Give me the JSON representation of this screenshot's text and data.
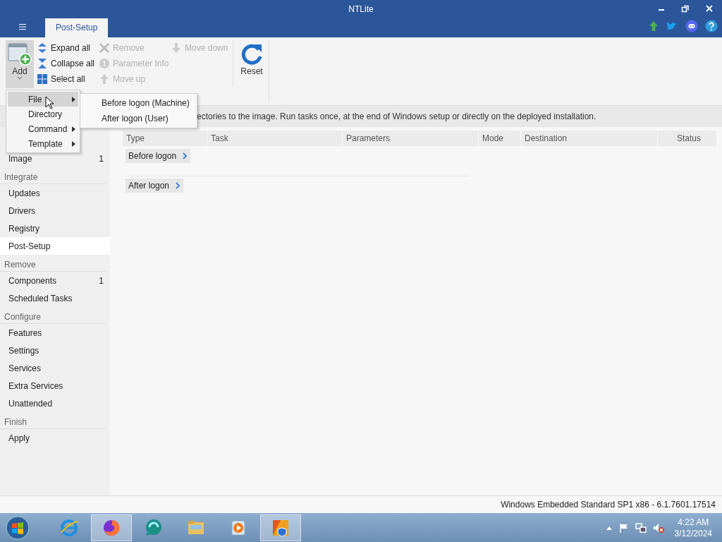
{
  "window": {
    "title": "NTLite"
  },
  "ribbon": {
    "tabs": [
      {
        "label": "Post-Setup",
        "selected": true
      }
    ],
    "add_button": {
      "label": "Add",
      "pressed": true
    },
    "small_columns": [
      [
        {
          "label": "Expand all",
          "disabled": false
        },
        {
          "label": "Collapse all",
          "disabled": false
        },
        {
          "label": "Select all",
          "disabled": false
        }
      ],
      [
        {
          "label": "Remove",
          "disabled": true
        },
        {
          "label": "Parameter Info",
          "disabled": true
        },
        {
          "label": "Move up",
          "disabled": true
        }
      ],
      [
        {
          "label": "Move down",
          "disabled": true
        }
      ]
    ],
    "reset_button": {
      "label": "Reset"
    }
  },
  "add_menu": {
    "items": [
      {
        "label": "File",
        "kind": "submenu",
        "selected": true
      },
      {
        "label": "Directory",
        "kind": "plain",
        "selected": false
      },
      {
        "label": "Command",
        "kind": "submenu",
        "selected": false
      },
      {
        "label": "Template",
        "kind": "submenu",
        "selected": false
      }
    ],
    "submenu": [
      "Before logon (Machine)",
      "After logon (User)"
    ]
  },
  "description": "ectories to the image. Run tasks once, at the end of Windows setup or directly on the deployed installation.",
  "sidebar": {
    "sections": [
      {
        "items": [
          {
            "label": "Image",
            "count": "1",
            "selected": false
          }
        ]
      },
      {
        "title": "Integrate",
        "items": [
          {
            "label": "Updates",
            "selected": false
          },
          {
            "label": "Drivers",
            "selected": false
          },
          {
            "label": "Registry",
            "selected": false
          },
          {
            "label": "Post-Setup",
            "selected": true
          }
        ]
      },
      {
        "title": "Remove",
        "items": [
          {
            "label": "Components",
            "count": "1",
            "selected": false
          },
          {
            "label": "Scheduled Tasks",
            "selected": false
          }
        ]
      },
      {
        "title": "Configure",
        "items": [
          {
            "label": "Features",
            "selected": false
          },
          {
            "label": "Settings",
            "selected": false
          },
          {
            "label": "Services",
            "selected": false
          },
          {
            "label": "Extra Services",
            "selected": false
          },
          {
            "label": "Unattended",
            "selected": false
          }
        ]
      },
      {
        "title": "Finish",
        "items": [
          {
            "label": "Apply",
            "selected": false
          }
        ]
      }
    ]
  },
  "table": {
    "columns": [
      "Type",
      "Task",
      "Parameters",
      "Mode",
      "Destination",
      "Status"
    ],
    "groups": [
      {
        "label": "Before logon",
        "expanded": false
      },
      {
        "label": "After logon",
        "expanded": false
      }
    ]
  },
  "status_bar": "Windows Embedded Standard SP1 x86 - 6.1.7601.17514",
  "taskbar": {
    "apps": [
      {
        "active": false
      },
      {
        "active": false
      },
      {
        "active": true
      },
      {
        "active": false
      },
      {
        "active": false
      },
      {
        "active": false
      },
      {
        "active": true
      }
    ],
    "time": "4:22 AM",
    "date": "3/12/2024"
  }
}
